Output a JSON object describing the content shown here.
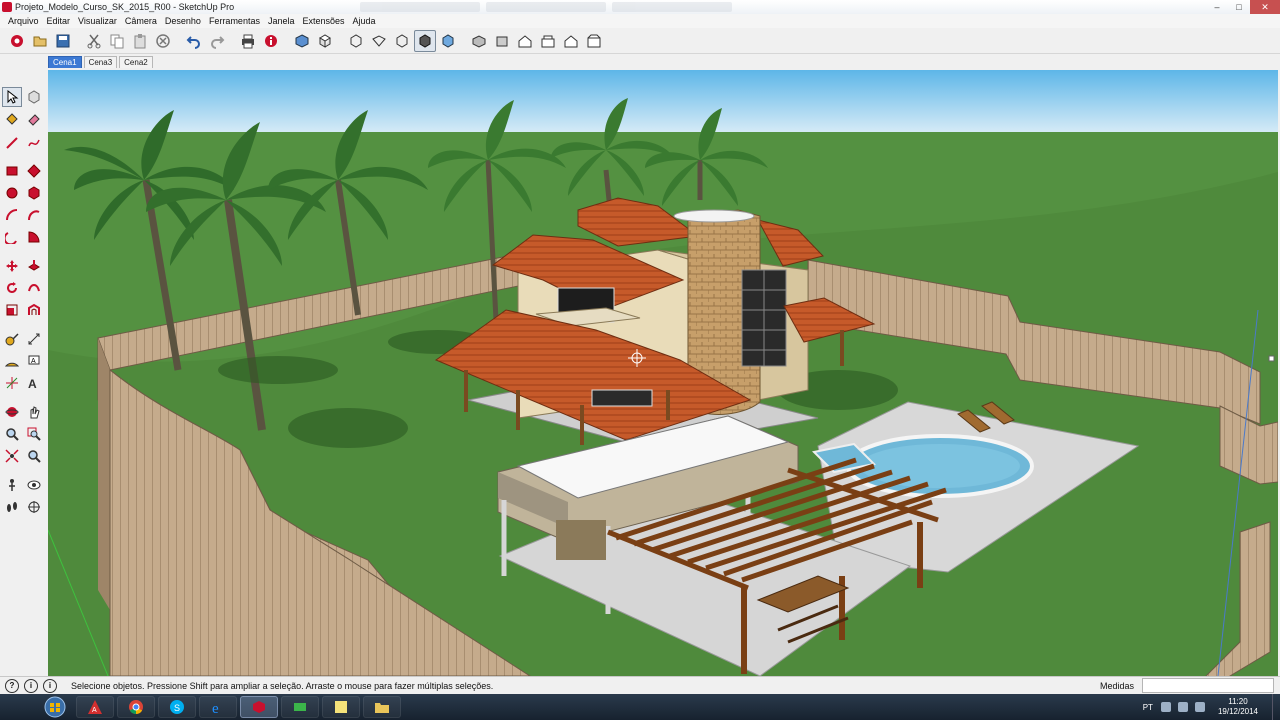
{
  "window": {
    "title": "Projeto_Modelo_Curso_SK_2015_R00 - SketchUp Pro",
    "minimize_glyph": "‒",
    "maximize_glyph": "□",
    "close_glyph": "✕"
  },
  "menu": [
    "Arquivo",
    "Editar",
    "Visualizar",
    "Câmera",
    "Desenho",
    "Ferramentas",
    "Janela",
    "Extensões",
    "Ajuda"
  ],
  "toolbar_icons": [
    "getting-started",
    "open-file",
    "save",
    "cut",
    "copy",
    "paste",
    "erase",
    "undo",
    "redo",
    "print",
    "model-info",
    "iso-view",
    "top-view",
    "xray",
    "wireframe",
    "hidden-line",
    "shaded",
    "shaded-texture",
    "monochrome",
    "orbit-3d",
    "front-view",
    "house-view",
    "right-view",
    "back-view",
    "left-view"
  ],
  "scene_tabs": [
    {
      "label": "Cena1",
      "active": true
    },
    {
      "label": "Cena3",
      "active": false
    },
    {
      "label": "Cena2",
      "active": false
    }
  ],
  "left_tools": [
    "select",
    "component",
    "paint-bucket",
    "eraser",
    "line",
    "freehand",
    "rectangle",
    "rotated-rectangle",
    "circle",
    "polygon",
    "arc",
    "arc-2pt",
    "arc-3pt",
    "pie",
    "move",
    "push-pull",
    "rotate",
    "follow-me",
    "scale",
    "offset",
    "tape-measure",
    "text",
    "dimension",
    "3d-text",
    "axes",
    "protractor",
    "orbit",
    "pan",
    "zoom",
    "zoom-window",
    "zoom-extents",
    "previous-view",
    "walk",
    "look-around",
    "position-camera",
    "section-plane"
  ],
  "status": {
    "icons": [
      "?",
      "i",
      "i"
    ],
    "message": "Selecione objetos. Pressione Shift para ampliar a seleção. Arraste o mouse para fazer múltiplas seleções.",
    "measure_label": "Medidas",
    "measure_value": ""
  },
  "taskbar": {
    "apps": [
      "windows-explorer",
      "autocad",
      "chrome",
      "skype",
      "internet-explorer",
      "sketchup",
      "camtasia",
      "sticky-notes",
      "folder"
    ],
    "language": "PT",
    "time": "11:20",
    "date": "19/12/2014"
  },
  "colors": {
    "sky_top": "#5db6e8",
    "sky_bottom": "#d9ecf7",
    "grass": "#4f8a3c",
    "roof": "#c65a2a",
    "pool": "#6fb8d8",
    "scene_tab_active": "#3c79d4"
  }
}
